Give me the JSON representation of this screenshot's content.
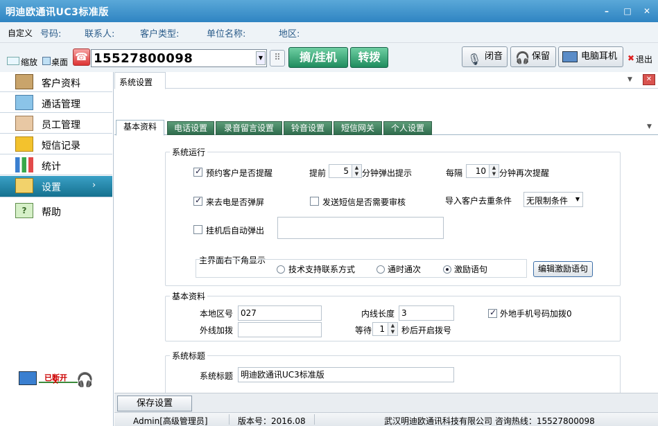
{
  "window": {
    "title": "明迪欧通讯UC3标准版",
    "min": "–",
    "max": "□",
    "close": "✕"
  },
  "infobar": {
    "custom": "自定义",
    "phone": "号码:",
    "contact": "联系人:",
    "ctype": "客户类型:",
    "company": "单位名称:",
    "region": "地区:"
  },
  "toolbar": {
    "shrink": "缩放",
    "desktop": "桌面",
    "phone_value": "15527800098",
    "pickup": "摘/挂机",
    "transfer": "转拨",
    "mute": "闭音",
    "hold": "保留",
    "headset": "电脑耳机",
    "exit": "退出"
  },
  "sidebar": {
    "items": [
      {
        "label": "客户资料"
      },
      {
        "label": "通话管理"
      },
      {
        "label": "员工管理"
      },
      {
        "label": "短信记录"
      },
      {
        "label": "统计"
      },
      {
        "label": "设置",
        "arrow": "›"
      },
      {
        "label": "帮助"
      }
    ],
    "status": "已断开"
  },
  "content": {
    "header_tab": "系统设置",
    "tabs": [
      "基本资料",
      "电话设置",
      "录音留言设置",
      "铃音设置",
      "短信网关",
      "个人设置"
    ],
    "system_run": {
      "title": "系统运行",
      "remind_label": "预约客户是否提醒",
      "advance_label": "提前",
      "advance_value": "5",
      "advance_suffix": "分钟弹出提示",
      "interval_label": "每隔",
      "interval_value": "10",
      "interval_suffix": "分钟再次提醒",
      "popup_label": "来去电是否弹屏",
      "sms_label": "发送短信是否需要审核",
      "import_label": "导入客户去重条件",
      "import_value": "无限制条件",
      "autopop_label": "挂机后自动弹出",
      "corner_title": "主界面右下角显示",
      "radio1": "技术支持联系方式",
      "radio2": "通时通次",
      "radio3": "激励语句",
      "edit_btn": "编辑激励语句"
    },
    "basic": {
      "title": "基本资料",
      "area_label": "本地区号",
      "area_value": "027",
      "inner_label": "内线长度",
      "inner_value": "3",
      "mobile_label": "外地手机号码加拨0",
      "prefix_label": "外线加拨",
      "prefix_value": "",
      "wait_label": "等待",
      "wait_value": "1",
      "wait_suffix": "秒后开启拨号"
    },
    "systitle": {
      "title": "系统标题",
      "label": "系统标题",
      "value": "明迪欧通讯UC3标准版"
    },
    "save_btn": "保存设置"
  },
  "status": {
    "user": "Admin[高级管理员]",
    "version": "版本号：2016.08",
    "company": "武汉明迪欧通讯科技有限公司 咨询热线：15527800098"
  }
}
